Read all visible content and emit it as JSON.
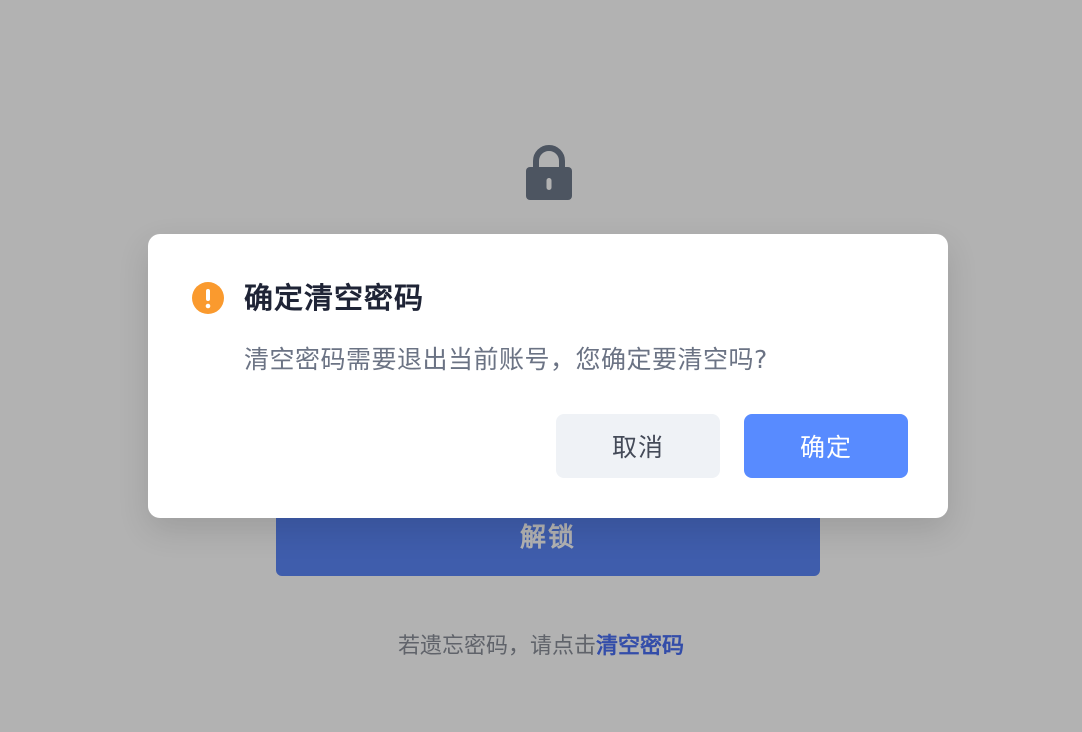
{
  "lock_screen": {
    "unlock_label": "解锁",
    "forgot_prefix": "若遗忘密码，请点击",
    "forgot_link": "清空密码"
  },
  "dialog": {
    "icon": "warning-icon",
    "title": "确定清空密码",
    "message": "清空密码需要退出当前账号，您确定要清空吗?",
    "cancel_label": "取消",
    "confirm_label": "确定"
  },
  "colors": {
    "warning": "#fa9a2e",
    "primary": "#588bff",
    "link": "#4a6ff3",
    "title": "#1f2436",
    "message": "#6b7384"
  }
}
